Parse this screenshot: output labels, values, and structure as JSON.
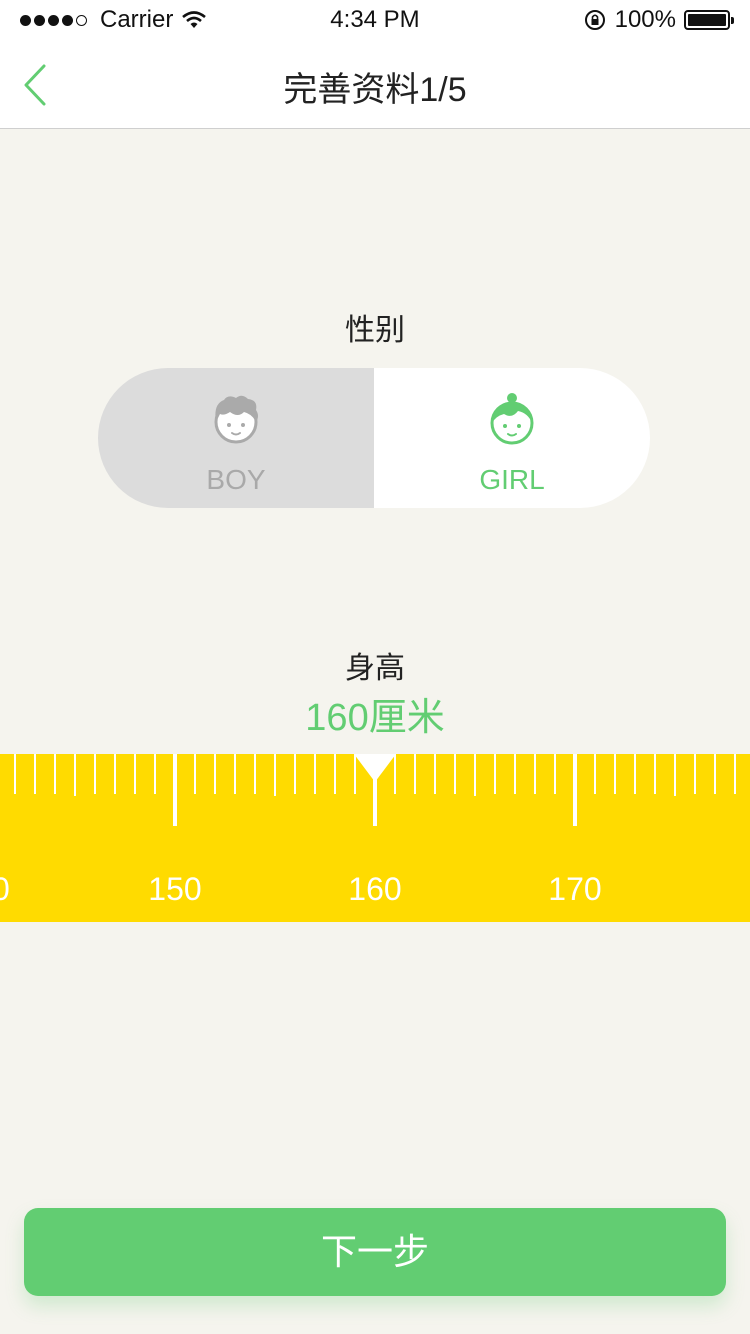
{
  "status_bar": {
    "carrier": "Carrier",
    "time": "4:34 PM",
    "battery": "100%"
  },
  "nav": {
    "title": "完善资料1/5"
  },
  "gender": {
    "label": "性别",
    "options": [
      {
        "label": "BOY",
        "selected": false
      },
      {
        "label": "GIRL",
        "selected": true
      }
    ]
  },
  "height": {
    "label": "身高",
    "value_text": "160厘米",
    "value": 160,
    "ruler_labels": [
      "150",
      "160",
      "170"
    ]
  },
  "next_button": {
    "label": "下一步"
  },
  "colors": {
    "accent": "#62cd72",
    "ruler": "#ffdb00",
    "background": "#f5f4ee"
  }
}
